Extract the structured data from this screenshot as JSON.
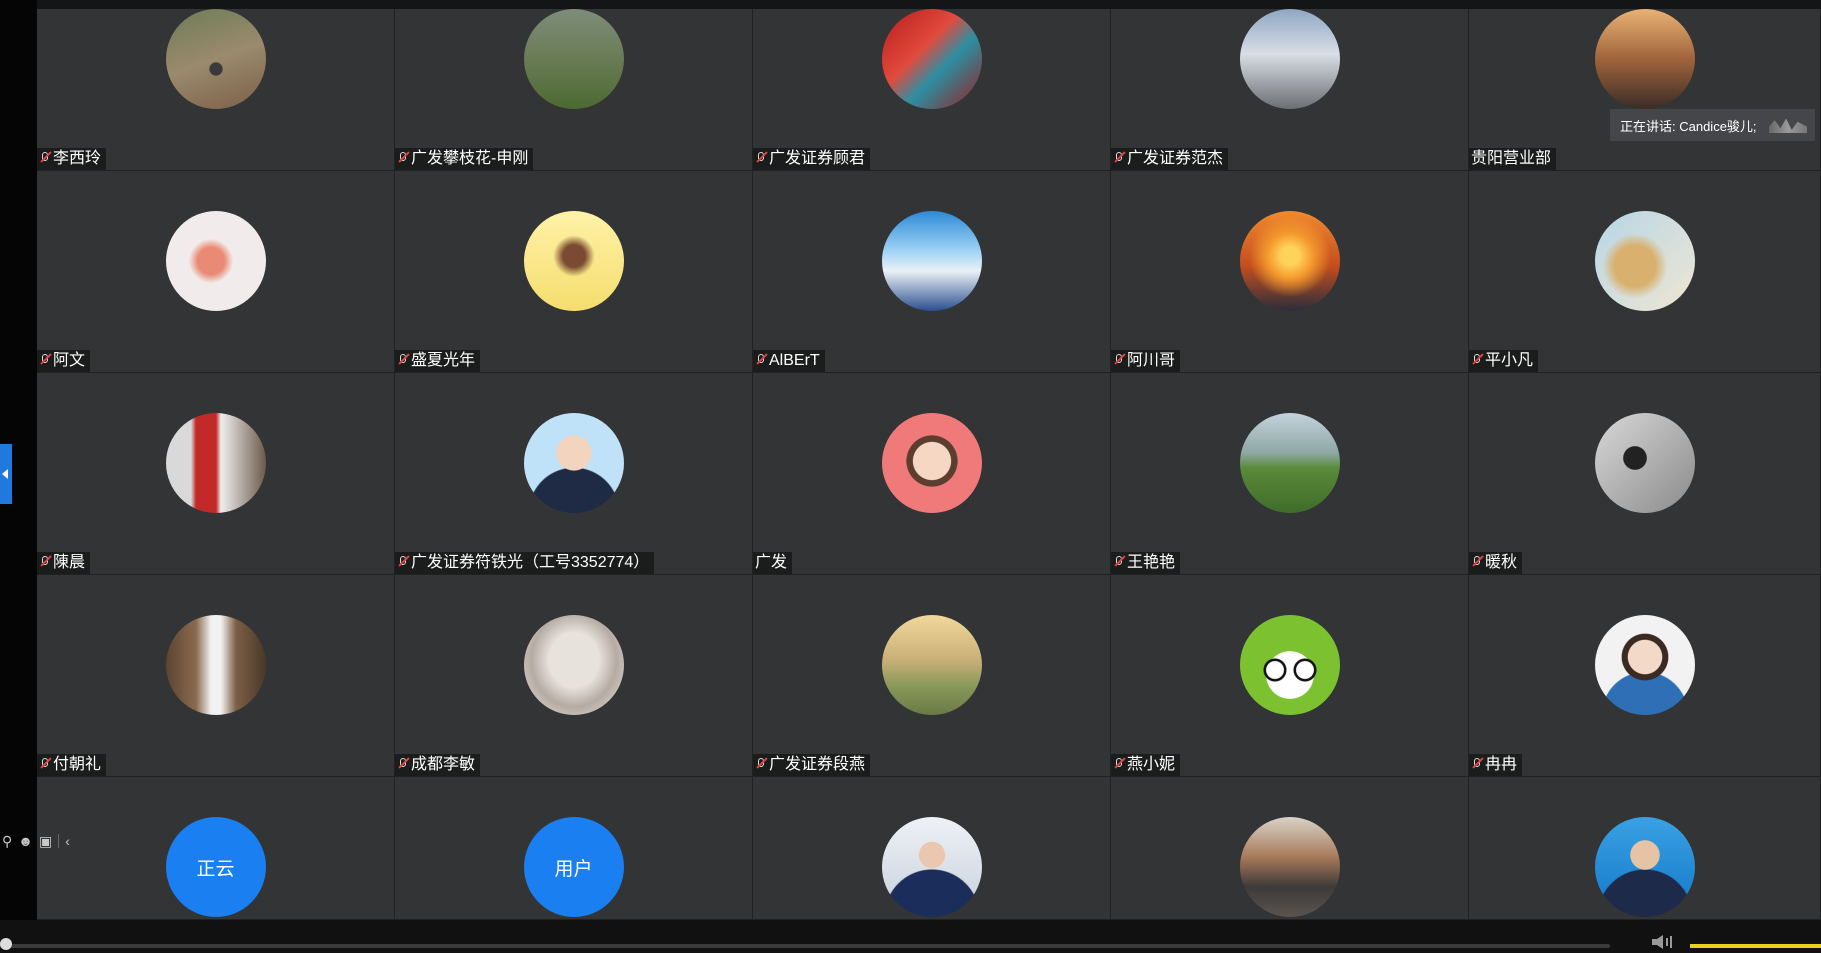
{
  "speaking_indicator": "正在讲话: Candice骏儿;",
  "participants": [
    {
      "name": "李西玲",
      "muted": true,
      "avatar": "photo"
    },
    {
      "name": "广发攀枝花-申刚",
      "muted": true,
      "avatar": "photo"
    },
    {
      "name": "广发证券顾君",
      "muted": true,
      "avatar": "photo"
    },
    {
      "name": "广发证券范杰",
      "muted": true,
      "avatar": "photo"
    },
    {
      "name": "贵阳营业部",
      "muted": false,
      "avatar": "photo"
    },
    {
      "name": "阿文",
      "muted": true,
      "avatar": "photo"
    },
    {
      "name": "盛夏光年",
      "muted": true,
      "avatar": "photo"
    },
    {
      "name": "AlBErT",
      "muted": true,
      "avatar": "photo"
    },
    {
      "name": "阿川哥",
      "muted": true,
      "avatar": "photo"
    },
    {
      "name": "平小凡",
      "muted": true,
      "avatar": "photo"
    },
    {
      "name": "陳晨",
      "muted": true,
      "avatar": "photo"
    },
    {
      "name": "广发证券符铁光（工号3352774）",
      "muted": true,
      "avatar": "photo"
    },
    {
      "name": "广发",
      "muted": false,
      "avatar": "photo"
    },
    {
      "name": "王艳艳",
      "muted": true,
      "avatar": "photo"
    },
    {
      "name": "暖秋",
      "muted": true,
      "avatar": "photo"
    },
    {
      "name": "付朝礼",
      "muted": true,
      "avatar": "photo"
    },
    {
      "name": "成都李敏",
      "muted": true,
      "avatar": "photo"
    },
    {
      "name": "广发证券段燕",
      "muted": true,
      "avatar": "photo"
    },
    {
      "name": "燕小妮",
      "muted": true,
      "avatar": "photo"
    },
    {
      "name": "冉冉",
      "muted": true,
      "avatar": "photo"
    },
    {
      "name": "",
      "avatar_text": "正云",
      "avatar": "text"
    },
    {
      "name": "",
      "avatar_text": "用户",
      "avatar": "text"
    },
    {
      "name": "",
      "avatar": "photo"
    },
    {
      "name": "",
      "avatar": "photo"
    },
    {
      "name": "",
      "avatar": "photo"
    }
  ],
  "colors": {
    "tile_bg": "#333436",
    "accent_blue": "#1a7ff0",
    "volume": "#e8d21b"
  },
  "icons": {
    "mini_toolbar": [
      "person-icon",
      "emoji-icon",
      "chat-icon",
      "collapse-left-icon"
    ]
  }
}
